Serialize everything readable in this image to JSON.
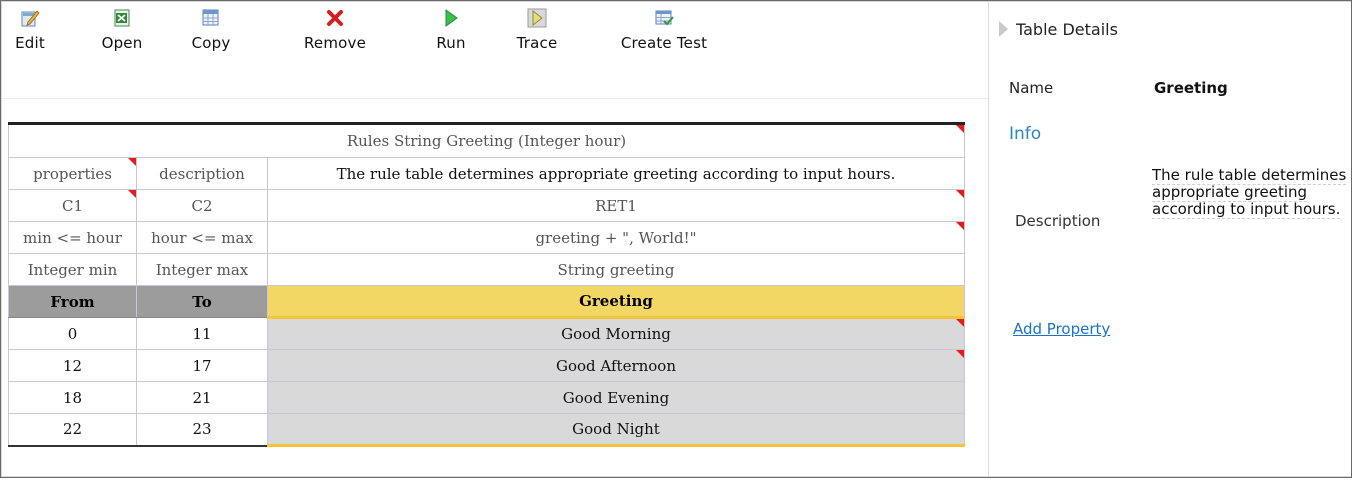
{
  "toolbar": {
    "edit": "Edit",
    "open": "Open",
    "copy": "Copy",
    "remove": "Remove",
    "run": "Run",
    "trace": "Trace",
    "create_test": "Create Test"
  },
  "table": {
    "header": "Rules String Greeting (Integer hour)",
    "properties": "properties",
    "description_label": "description",
    "description": "The rule table determines appropriate greeting according to input hours.",
    "cols": [
      "C1",
      "C2",
      "RET1"
    ],
    "expressions": [
      "min <= hour",
      "hour <= max",
      "greeting + \", World!\""
    ],
    "params": [
      "Integer min",
      "Integer max",
      "String greeting"
    ],
    "titles": [
      "From",
      "To",
      "Greeting"
    ],
    "rows": [
      [
        "0",
        "11",
        "Good Morning"
      ],
      [
        "12",
        "17",
        "Good Afternoon"
      ],
      [
        "18",
        "21",
        "Good Evening"
      ],
      [
        "22",
        "23",
        "Good Night"
      ]
    ]
  },
  "panel": {
    "title": "Table Details",
    "name_label": "Name",
    "name_value": "Greeting",
    "info": "Info",
    "description_label": "Description",
    "description_value": "The rule table determines appropriate greeting according to input hours.",
    "add_property": "Add Property"
  },
  "colors": {
    "return_header": "#f2d765",
    "condition_header": "#9c9c9c",
    "link": "#1a73c8",
    "info": "#2a86c8",
    "comment_marker": "#e21b1b"
  }
}
